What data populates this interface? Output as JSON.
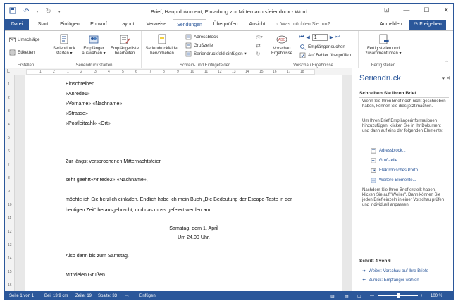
{
  "title": "Brief, Hauptdokument, Einladung zur Mitternachtsfeier.docx - Word",
  "quick_access": {
    "save_icon": "save-icon",
    "undo_icon": "undo-icon",
    "redo_icon": "redo-icon",
    "customize_icon": "chevron-down-icon"
  },
  "window_controls": {
    "ribbon_options": "⊡",
    "minimize": "—",
    "maximize": "☐",
    "close": "✕"
  },
  "tabs": [
    "Datei",
    "Start",
    "Einfügen",
    "Entwurf",
    "Layout",
    "Verweise",
    "Sendungen",
    "Überprüfen",
    "Ansicht"
  ],
  "active_tab": "Sendungen",
  "tell_me": "Was möchten Sie tun?",
  "sign_in": "Anmelden",
  "share": "Freigeben",
  "ribbon": {
    "erstellen": {
      "label": "Erstellen",
      "umschlaege": "Umschläge",
      "etiketten": "Etiketten"
    },
    "seriendruck_starten": {
      "label": "Seriendruck starten",
      "btn1": [
        "Seriendruck",
        "starten ▾"
      ],
      "btn2": [
        "Empfänger",
        "auswählen ▾"
      ],
      "btn3": [
        "Empfängerliste",
        "bearbeiten"
      ]
    },
    "schreib": {
      "label": "Schreib- und Einfügefelder",
      "btn1": [
        "Seriendruckfelder",
        "hervorheben"
      ],
      "adressblock": "Adressblock",
      "grusszeile": "Grußzeile",
      "seriendruckfeld": "Seriendruckfeld einfügen ▾"
    },
    "vorschau": {
      "label": "Vorschau Ergebnisse",
      "btn1": [
        "Vorschau",
        "Ergebnisse"
      ],
      "record": "1",
      "empfaenger_suchen": "Empfänger suchen",
      "fehler": "Auf Fehler überprüfen"
    },
    "fertig": {
      "label": "Fertig stellen",
      "btn1": [
        "Fertig stellen und",
        "zusammenführen ▾"
      ]
    }
  },
  "ruler": {
    "numbers": [
      "1",
      "2",
      "1",
      "2",
      "3",
      "4",
      "5",
      "6",
      "7",
      "8",
      "9",
      "10",
      "11",
      "12",
      "13",
      "14",
      "15",
      "16",
      "17",
      "18"
    ]
  },
  "vruler": {
    "numbers": [
      "1",
      "2",
      "3",
      "4",
      "5",
      "6",
      "7",
      "8",
      "9",
      "10",
      "11",
      "12",
      "13",
      "14",
      "15",
      "16"
    ]
  },
  "document": {
    "lines": [
      "Einschreiben",
      "«Anrede1»",
      "«Vorname» «Nachname»",
      "«Strasse»",
      "«Postleitzahl» «Ort»",
      "Zur längst versprochenen Mitternachtsfeier,",
      "sehr geehrt«Anrede2» «Nachname»,",
      "möchte ich Sie herzlich einladen. Endlich habe ich mein Buch „Die Bedeutung der Escape-Taste in der",
      "heutigen Zeit“ herausgebracht, und das muss gefeiert werden am",
      "Samstag, dem 1. April",
      "Um 24.00 Uhr.",
      "Also dann bis zum Samstag.",
      "Mit vielen Grüßen"
    ]
  },
  "pane": {
    "title": "Seriendruck",
    "controls": "▾ ✕",
    "heading": "Schreiben Sie Ihren Brief",
    "text1": "Wenn Sie Ihren Brief noch nicht geschrieben haben, können Sie dies jetzt machen.",
    "text2": "Um Ihren Brief Empfängerinformationen hinzuzufügen, klicken Sie in Ihr Dokument und dann auf eins der folgenden Elemente:",
    "links": [
      "Adressblock...",
      "Grußzeile...",
      "Elektronisches Porto...",
      "Weitere Elemente..."
    ],
    "text3": "Nachdem Sie Ihren Brief erstellt haben, klicken Sie auf \"Weiter\". Dann können Sie jeden Brief einzeln in einer Vorschau prüfen und individuell anpassen.",
    "step": "Schritt 4 von 6",
    "next": "Weiter: Vorschau auf Ihre Briefe",
    "back": "Zurück: Empfänger wählen"
  },
  "status": {
    "page": "Seite 1 von 1",
    "position": "Bei: 13,9 cm",
    "line": "Zeile: 19",
    "column": "Spalte: 33",
    "mode": "Einfügen",
    "zoom": "100 %"
  }
}
